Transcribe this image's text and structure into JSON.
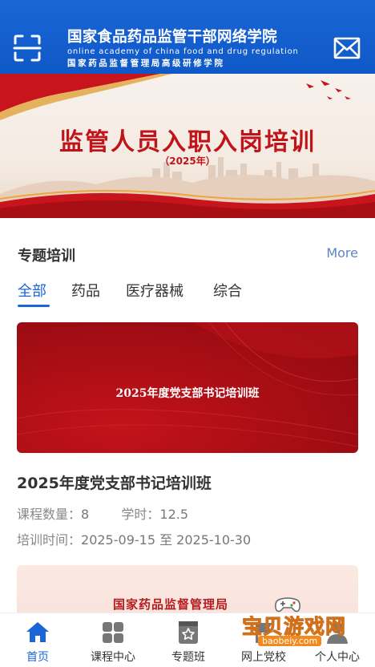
{
  "header": {
    "title_cn": "国家食品药品监管干部网络学院",
    "title_en": "online academy of china food and drug regulation",
    "subtitle_cn": "国家药品监督管理局高级研修学院",
    "scan_icon": "scan-icon",
    "mail_icon": "mail-icon"
  },
  "banner": {
    "title": "监管人员入职入岗培训",
    "year": "（2025年）"
  },
  "section": {
    "title": "专题培训",
    "more": "More",
    "tabs": [
      {
        "label": "全部",
        "active": true
      },
      {
        "label": "药品",
        "active": false
      },
      {
        "label": "医疗器械",
        "active": false
      },
      {
        "label": "综合",
        "active": false
      }
    ]
  },
  "card": {
    "image_text": "2025年度党支部书记培训班",
    "title": "2025年度党支部书记培训班",
    "course_count_label": "课程数量：",
    "course_count": "8",
    "hours_label": "学时：",
    "hours": "12.5",
    "time_label": "培训时间：",
    "time_range": "2025-09-15 至 2025-10-30"
  },
  "card2": {
    "image_text": "国家药品监督管理局"
  },
  "bottom_nav": [
    {
      "label": "首页",
      "icon": "home-icon",
      "active": true
    },
    {
      "label": "课程中心",
      "icon": "grid-icon",
      "active": false
    },
    {
      "label": "专题班",
      "icon": "star-box-icon",
      "active": false
    },
    {
      "label": "网上党校",
      "icon": "flag-icon",
      "active": false
    },
    {
      "label": "个人中心",
      "icon": "user-icon",
      "active": false
    }
  ],
  "watermark": {
    "text": "宝贝游戏网",
    "url": "baobeiy.com"
  },
  "colors": {
    "brand_blue": "#1a66d6",
    "banner_red": "#c0141b",
    "card_red": "#a60d14"
  }
}
